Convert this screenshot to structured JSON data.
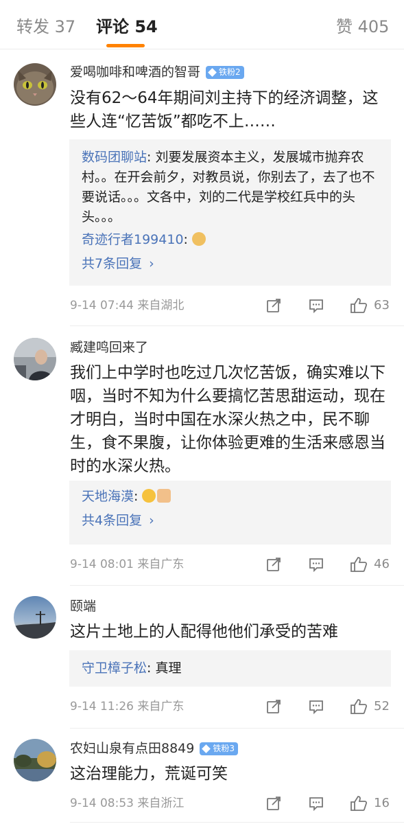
{
  "tabs": {
    "repost": "转发 37",
    "comments": "评论 54",
    "likes": "赞 405",
    "active_color": "#ff8200"
  },
  "icons": {
    "share": "share-icon",
    "comment": "comment-icon",
    "like": "thumbs-up-icon",
    "badge": "diamond-icon",
    "more": "chevron-right-icon"
  },
  "comments": [
    {
      "username": "爱喝咖啡和啤酒的智哥",
      "badge": "铁粉2",
      "text": "没有62～64年期间刘主持下的经济调整，这些人连“忆苦饭”都吃不上……",
      "replies": [
        {
          "name": "数码团聊站",
          "text": "刘要发展资本主义，发展城市抛弃农村。。在开会前夕，对教员说，你别去了，去了也不要说话。。。文各中，刘的二代是学校红兵中的头头。。。"
        },
        {
          "name": "奇迹行者199410",
          "text": "",
          "emoji": "doge"
        }
      ],
      "more": "共7条回复",
      "time": "9-14 07:44",
      "location": "来自湖北",
      "likes": "63"
    },
    {
      "username": "臧建鸣回来了",
      "badge": "",
      "text": "我们上中学时也吃过几次忆苦饭，确实难以下咽，当时不知为什么要搞忆苦思甜运动，现在才明白，当时中国在水深火热之中，民不聊生，食不果腹，让你体验更难的生活来感恩当时的水深火热。",
      "replies": [
        {
          "name": "天地海漠",
          "text": "",
          "emoji": "laugh + thumbs up"
        }
      ],
      "more": "共4条回复",
      "time": "9-14 08:01",
      "location": "来自广东",
      "likes": "46"
    },
    {
      "username": "颐端",
      "badge": "",
      "text": "这片土地上的人配得他他们承受的苦难",
      "replies": [
        {
          "name": "守卫樟子松",
          "text": "真理"
        }
      ],
      "time": "9-14 11:26",
      "location": "来自广东",
      "likes": "52"
    },
    {
      "username": "农妇山泉有点田8849",
      "badge": "铁粉3",
      "text": "这治理能力，荒诞可笑",
      "time": "9-14 08:53",
      "location": "来自浙江",
      "likes": "16"
    }
  ]
}
